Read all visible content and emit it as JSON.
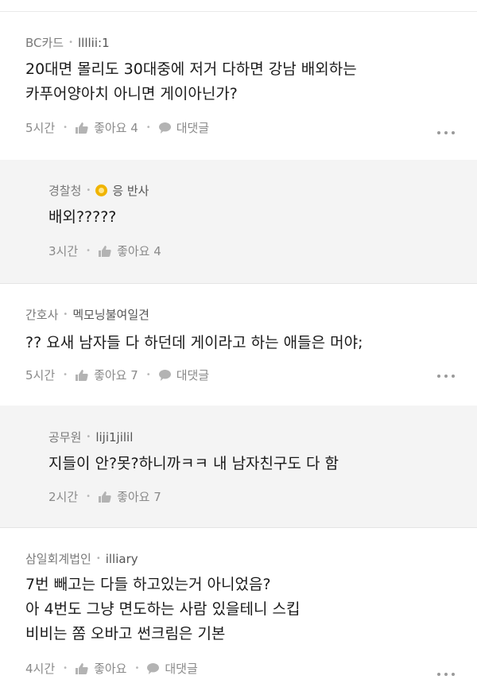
{
  "comments": [
    {
      "author": "BC카드",
      "nickname": "llllii:1",
      "lines": [
        "20대면 몰리도 30대중에 저거 다하면 강남 배외하는",
        "카푸어양아치 아니면 게이아닌가?"
      ],
      "time": "5시간",
      "like_label": "좋아요 4",
      "reply_label": "대댓글"
    },
    {
      "author": "경찰청",
      "nickname": "응 반사",
      "lines": [
        "배외?????"
      ],
      "time": "3시간",
      "like_label": "좋아요 4"
    },
    {
      "author": "간호사",
      "nickname": "멕모닝불여일견",
      "lines": [
        "?? 요새 남자들 다 하던데 게이라고 하는 애들은 머야;"
      ],
      "time": "5시간",
      "like_label": "좋아요 7",
      "reply_label": "대댓글"
    },
    {
      "author": "공무원",
      "nickname": "liji1jilil",
      "lines": [
        "지들이 안?못?하니까ㅋㅋ 내 남자친구도 다 함"
      ],
      "time": "2시간",
      "like_label": "좋아요 7"
    },
    {
      "author": "삼일회계법인",
      "nickname": "illiary",
      "lines": [
        "7번 빼고는 다들 하고있는거 아니었음?",
        "아 4번도 그냥 면도하는 사람 있을테니 스킵",
        "비비는 쫌 오바고 썬크림은 기본"
      ],
      "time": "4시간",
      "like_label": "좋아요",
      "reply_label": "대댓글"
    }
  ],
  "icons": {
    "like": "thumbs-up-icon",
    "reply": "speech-bubble-icon",
    "more": "more-dots-icon",
    "badge": "coin-badge-icon"
  },
  "colors": {
    "reply_background": "#f4f4f4",
    "badge": "#f0b400",
    "meta_text": "#7a7a7a"
  }
}
